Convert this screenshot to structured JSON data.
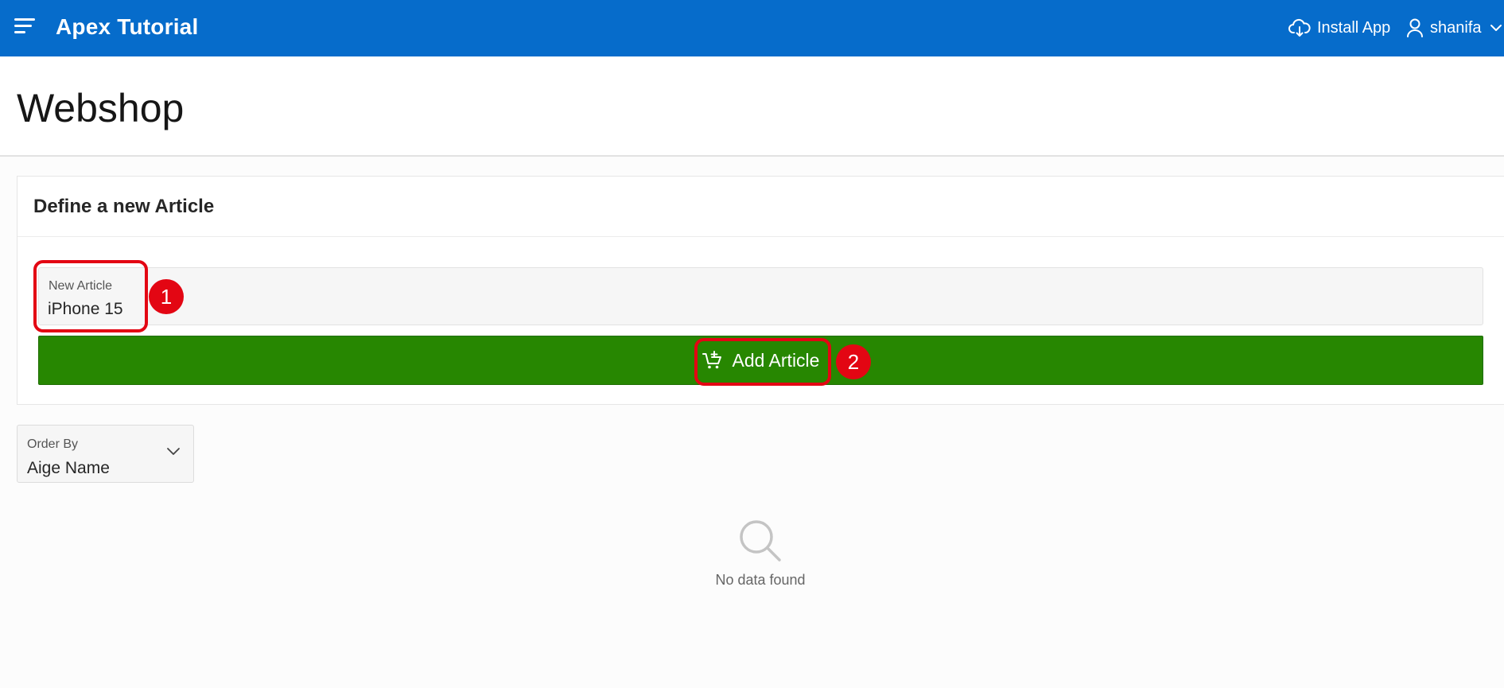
{
  "header": {
    "app_title": "Apex Tutorial",
    "install_app_label": "Install App",
    "user_name": "shanifa",
    "icons": [
      "menu-icon",
      "cloud-download-icon",
      "user-icon",
      "chevron-down-icon"
    ],
    "background_color": "#066ccb"
  },
  "page": {
    "title": "Webshop"
  },
  "region": {
    "title": "Define a new Article",
    "new_article_field": {
      "label": "New Article",
      "value": "iPhone 15"
    },
    "add_button": {
      "label": "Add Article",
      "icon": "cart-add-icon",
      "color": "#278701"
    }
  },
  "annotations": {
    "step_1": "1",
    "step_2": "2",
    "color": "#e30613"
  },
  "order_by": {
    "label": "Order By",
    "value": "Aige Name"
  },
  "results": {
    "empty_message": "No data found",
    "icon": "search-icon"
  }
}
